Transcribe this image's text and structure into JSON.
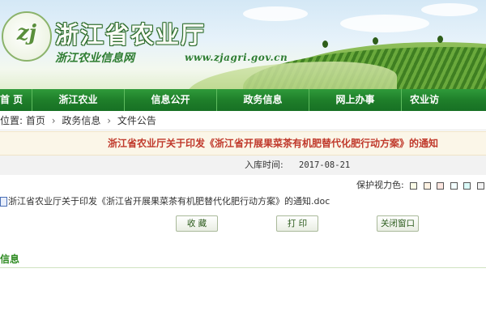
{
  "header": {
    "logo_text": "zj",
    "site_title": "浙江省农业厅",
    "site_subtitle": "浙江农业信息网",
    "site_url": "www.zjagri.gov.cn"
  },
  "nav": {
    "items": [
      {
        "label": "首  页"
      },
      {
        "label": "浙江农业"
      },
      {
        "label": "信息公开"
      },
      {
        "label": "政务信息"
      },
      {
        "label": "网上办事"
      },
      {
        "label": "农业访"
      }
    ]
  },
  "breadcrumb": {
    "prefix": "位置:",
    "items": [
      "首页",
      "政务信息",
      "文件公告"
    ],
    "separator": "›"
  },
  "article": {
    "title": "浙江省农业厅关于印发《浙江省开展果菜茶有机肥替代化肥行动方案》的通知",
    "date_label": "入库时间:",
    "date_value": "2017-08-21",
    "eye_care_label": "保护视力色:",
    "eye_care_colors": [
      "#fafbe6",
      "#fff2e2",
      "#fde6e0",
      "#f3ffff",
      "#dafaf8",
      "#f2f2f2"
    ],
    "attachment": "浙江省农业厅关于印发《浙江省开展果菜茶有机肥替代化肥行动方案》的通知.doc"
  },
  "buttons": {
    "favorite": "收  藏",
    "print": "打  印",
    "close": "关闭窗口"
  },
  "related": {
    "label": "信息"
  },
  "colors": {
    "nav_green": "#1f7f2a",
    "title_red": "#c0392b",
    "accent_green": "#2e8b22"
  }
}
